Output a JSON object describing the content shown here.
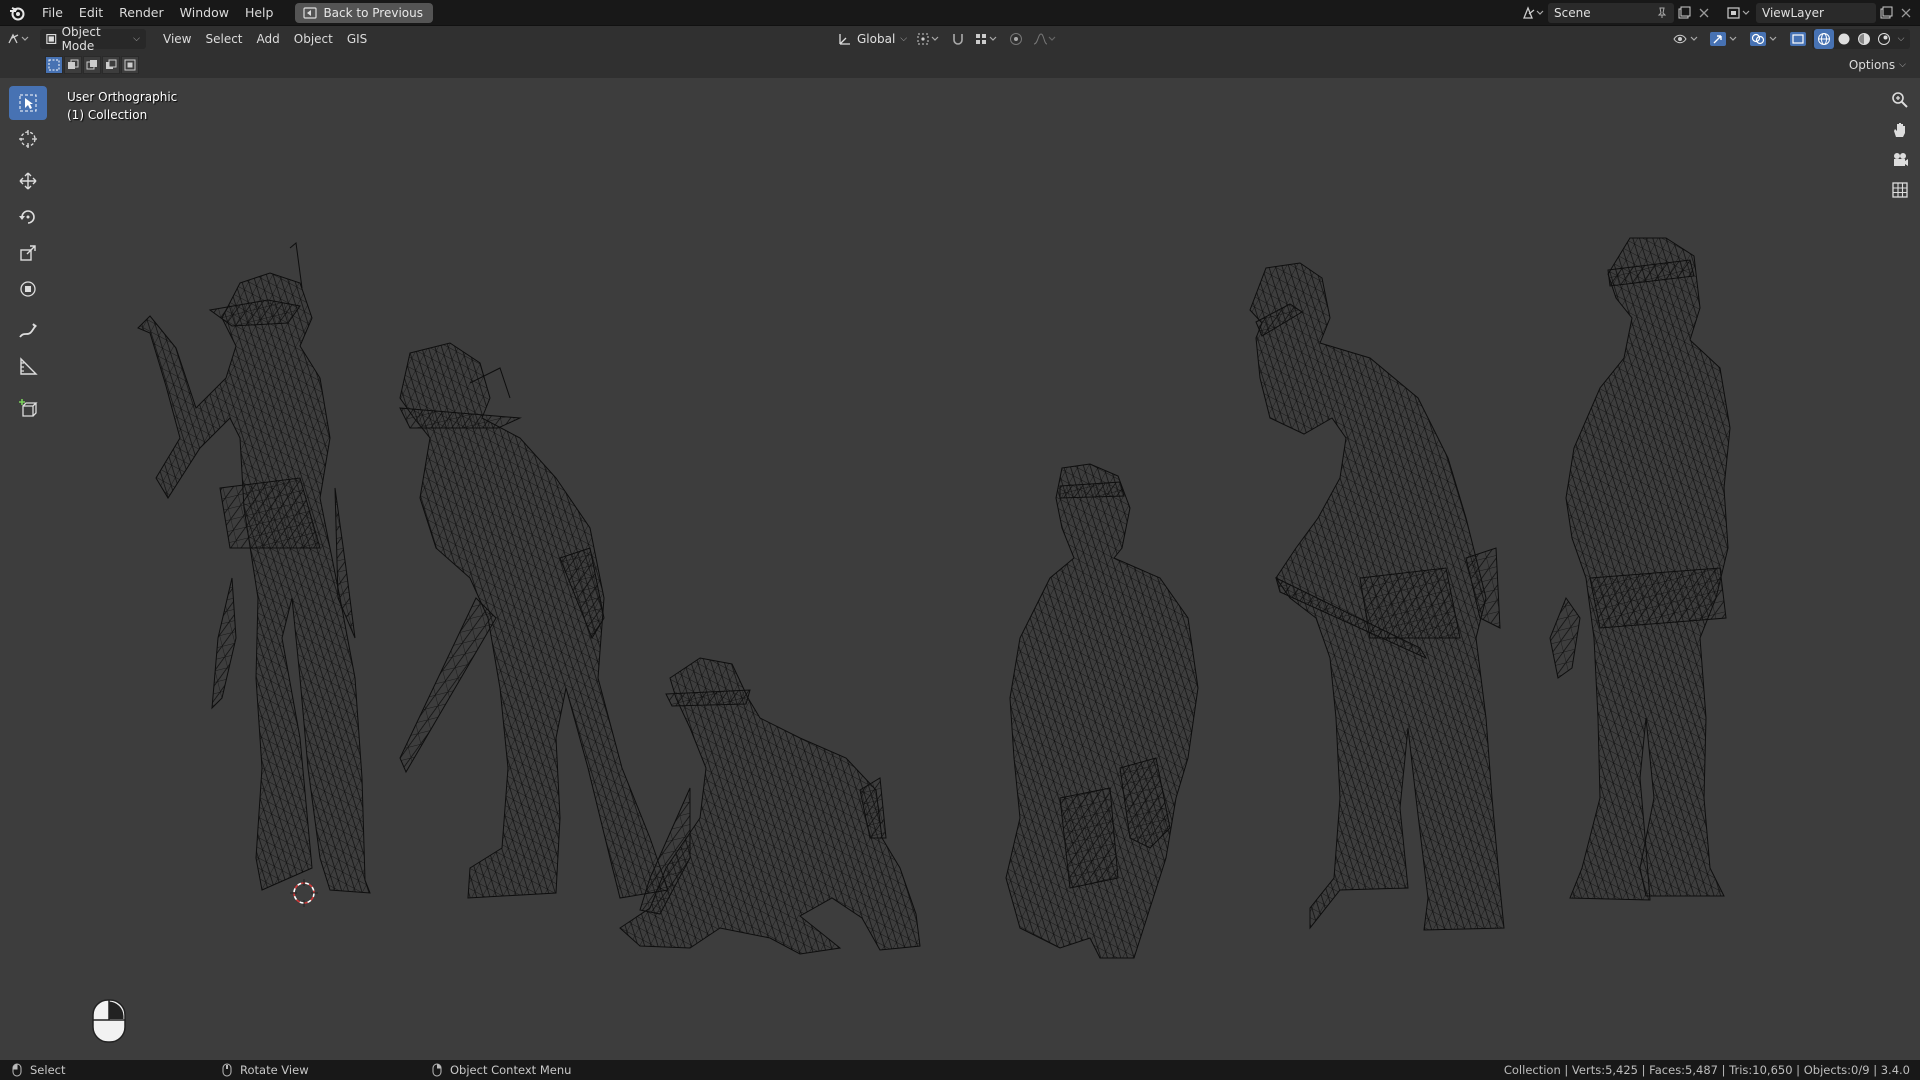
{
  "topbar": {
    "menus": [
      "File",
      "Edit",
      "Render",
      "Window",
      "Help"
    ],
    "back_button": "Back to Previous",
    "scene": "Scene",
    "view_layer": "ViewLayer"
  },
  "header": {
    "mode": "Object Mode",
    "menus": [
      "View",
      "Select",
      "Add",
      "Object",
      "GIS"
    ],
    "orientation": "Global"
  },
  "subheader": {
    "options": "Options"
  },
  "viewport": {
    "view_name": "User Orthographic",
    "collection": "(1) Collection",
    "background": "#3d3d3d",
    "wire_color": "#111111"
  },
  "toolbar": {
    "tools": [
      "select-box",
      "cursor",
      "move",
      "rotate",
      "scale",
      "transform",
      "annotate",
      "measure",
      "add-cube"
    ],
    "active": "select-box",
    "accent": "#4772b3"
  },
  "statusbar": {
    "select": "Select",
    "rotate": "Rotate View",
    "context": "Object Context Menu",
    "stats": "Collection | Verts:5,425 | Faces:5,487 | Tris:10,650 | Objects:0/9 | 3.4.0"
  }
}
